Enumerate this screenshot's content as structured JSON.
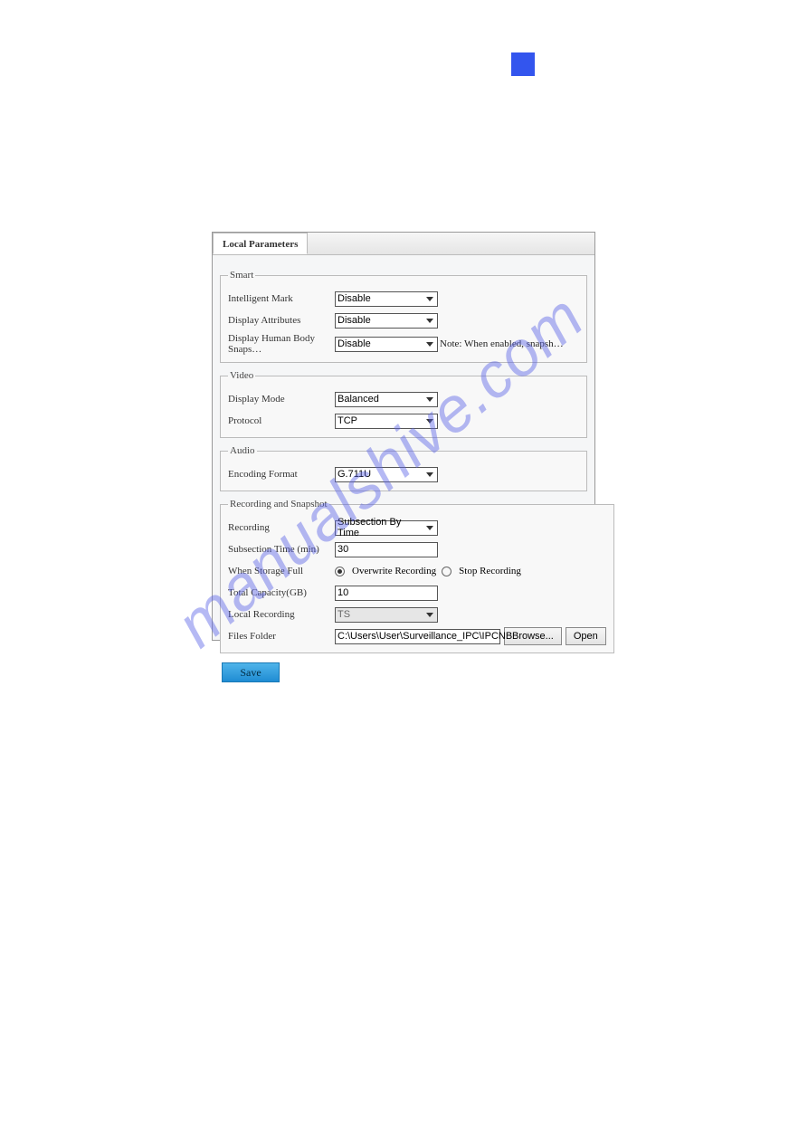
{
  "tab": {
    "label": "Local Parameters"
  },
  "smart": {
    "legend": "Smart",
    "intelligent_mark_label": "Intelligent Mark",
    "intelligent_mark_value": "Disable",
    "display_attributes_label": "Display Attributes",
    "display_attributes_value": "Disable",
    "display_human_label": "Display Human Body Snaps…",
    "display_human_value": "Disable",
    "display_human_note": "Note: When enabled, snapsh…"
  },
  "video": {
    "legend": "Video",
    "display_mode_label": "Display Mode",
    "display_mode_value": "Balanced",
    "protocol_label": "Protocol",
    "protocol_value": "TCP"
  },
  "audio": {
    "legend": "Audio",
    "encoding_label": "Encoding Format",
    "encoding_value": "G.711U"
  },
  "rec": {
    "legend": "Recording and Snapshot",
    "recording_label": "Recording",
    "recording_value": "Subsection By Time",
    "subsection_label": "Subsection Time (min)",
    "subsection_value": "30",
    "storage_full_label": "When Storage Full",
    "overwrite_label": "Overwrite Recording",
    "stop_label": "Stop Recording",
    "storage_selected": "overwrite",
    "total_capacity_label": "Total Capacity(GB)",
    "total_capacity_value": "10",
    "local_recording_label": "Local Recording",
    "local_recording_value": "TS",
    "files_folder_label": "Files Folder",
    "files_folder_value": "C:\\Users\\User\\Surveillance_IPC\\IPCNB",
    "browse_label": "Browse...",
    "open_label": "Open"
  },
  "save_label": "Save",
  "watermark": "manualshive.com"
}
